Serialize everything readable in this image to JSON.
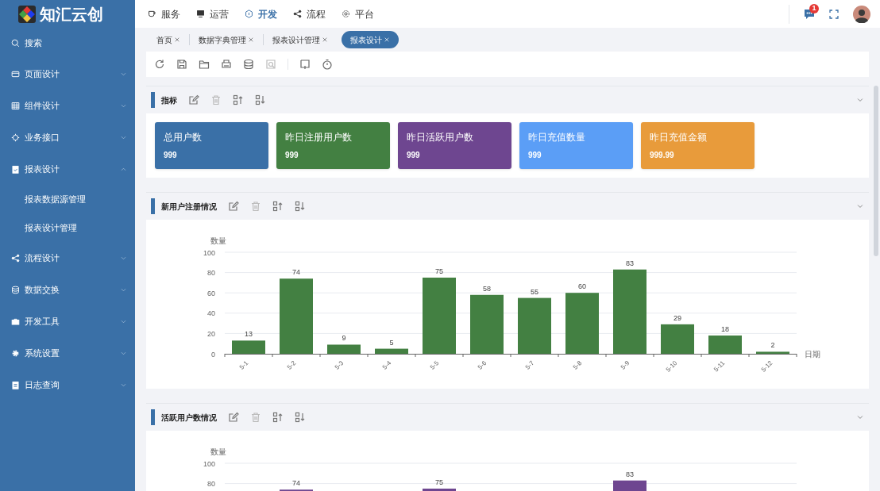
{
  "logo": {
    "text": "知汇云创"
  },
  "sidebar": {
    "search": "搜索",
    "items": [
      {
        "label": "页面设计",
        "expanded": false
      },
      {
        "label": "组件设计",
        "expanded": false
      },
      {
        "label": "业务接口",
        "expanded": false
      },
      {
        "label": "报表设计",
        "expanded": true,
        "children": [
          {
            "label": "报表数据源管理"
          },
          {
            "label": "报表设计管理"
          }
        ]
      },
      {
        "label": "流程设计",
        "expanded": false
      },
      {
        "label": "数据交换",
        "expanded": false
      },
      {
        "label": "开发工具",
        "expanded": false
      },
      {
        "label": "系统设置",
        "expanded": false
      },
      {
        "label": "日志查询",
        "expanded": false
      }
    ]
  },
  "top_nav": [
    {
      "label": "服务",
      "selected": false
    },
    {
      "label": "运营",
      "selected": false
    },
    {
      "label": "开发",
      "selected": true
    },
    {
      "label": "流程",
      "selected": false
    },
    {
      "label": "平台",
      "selected": false
    }
  ],
  "notifications": {
    "count": "1"
  },
  "tabs": [
    {
      "label": "首页",
      "selected": false
    },
    {
      "label": "数据字典管理",
      "selected": false
    },
    {
      "label": "报表设计管理",
      "selected": false
    },
    {
      "label": "报表设计",
      "selected": true
    }
  ],
  "panels": [
    {
      "kind": "cards",
      "title": "指标",
      "cards": [
        {
          "label": "总用户数",
          "value": "999",
          "color": "#3a70a7"
        },
        {
          "label": "昨日注册用户数",
          "value": "999",
          "color": "#438042"
        },
        {
          "label": "昨日活跃用户数",
          "value": "999",
          "color": "#6e4690"
        },
        {
          "label": "昨日充值数量",
          "value": "999",
          "color": "#5b9ef6"
        },
        {
          "label": "昨日充值金额",
          "value": "999.99",
          "color": "#e89b3b"
        }
      ]
    },
    {
      "kind": "chart",
      "title": "新用户注册情况",
      "chart_data": {
        "type": "bar",
        "xlabel": "日期",
        "ylabel": "数量",
        "categories": [
          "5-1",
          "5-2",
          "5-3",
          "5-4",
          "5-5",
          "5-6",
          "5-7",
          "5-8",
          "5-9",
          "5-10",
          "5-11",
          "5-12"
        ],
        "series": [
          {
            "color": "#438042",
            "values": [
              13,
              74,
              9,
              5,
              75,
              58,
              55,
              60,
              83,
              29,
              18,
              2
            ]
          }
        ],
        "ylim": [
          0,
          100
        ],
        "yticks": [
          0,
          20,
          40,
          60,
          80,
          100
        ],
        "grid": true,
        "data_labels": true
      }
    },
    {
      "kind": "chart",
      "title": "活跃用户数情况",
      "chart_data": {
        "type": "bar",
        "ylabel": "数量",
        "series": [
          {
            "color": "#6e4690",
            "values": [
              null,
              74,
              null,
              null,
              75,
              null,
              null,
              null,
              83,
              null,
              null,
              null
            ]
          }
        ],
        "ylim": [
          0,
          100
        ],
        "yticks": [
          80,
          100
        ],
        "grid": true,
        "data_labels": true
      }
    }
  ]
}
